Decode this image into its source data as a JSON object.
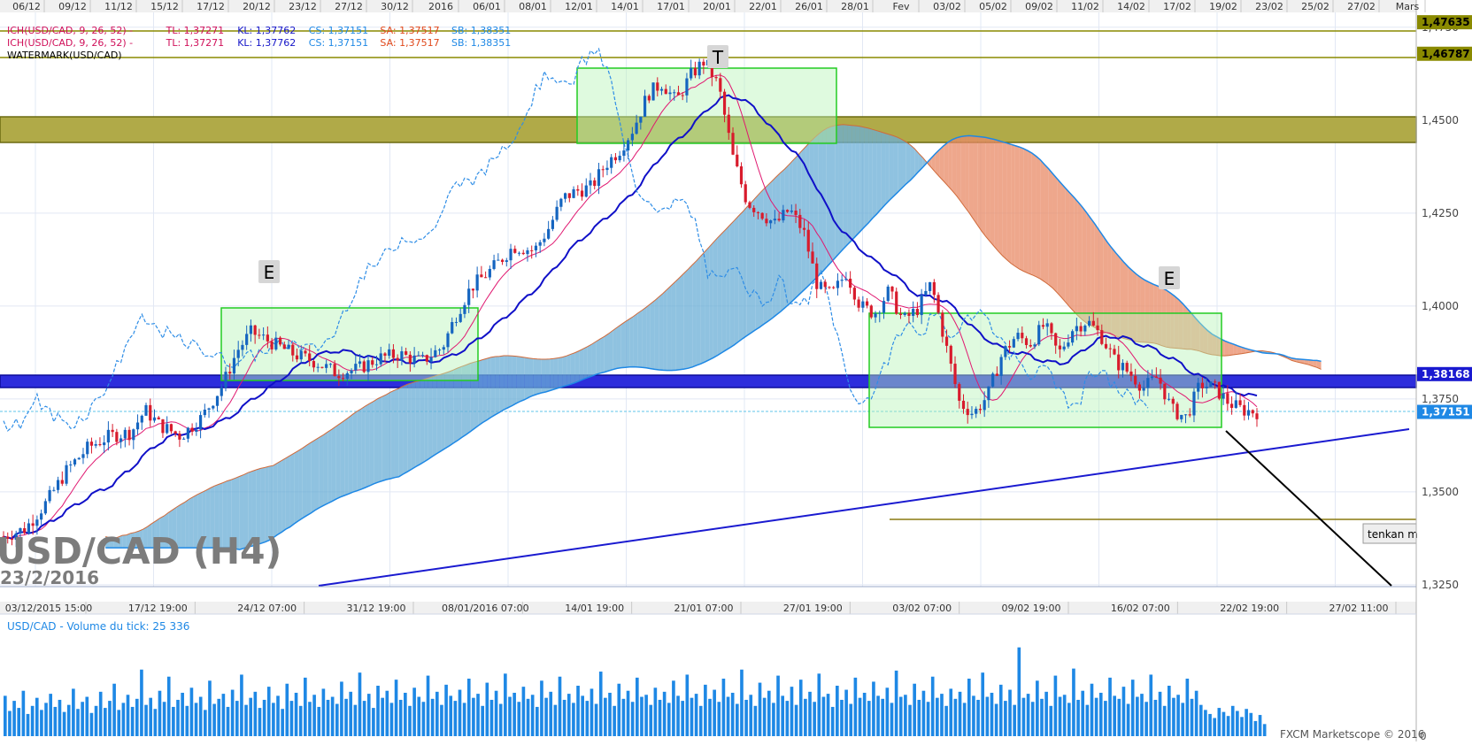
{
  "top_dates": [
    "06/12",
    "09/12",
    "11/12",
    "15/12",
    "17/12",
    "20/12",
    "23/12",
    "27/12",
    "30/12",
    "2016",
    "06/01",
    "08/01",
    "12/01",
    "14/01",
    "17/01",
    "20/01",
    "22/01",
    "26/01",
    "28/01",
    "Fev",
    "03/02",
    "05/02",
    "09/02",
    "11/02",
    "14/02",
    "17/02",
    "19/02",
    "23/02",
    "25/02",
    "27/02",
    "Mars"
  ],
  "bottom_dates": [
    "03/12/2015 15:00",
    "17/12 19:00",
    "24/12 07:00",
    "31/12 19:00",
    "08/01/2016 07:00",
    "14/01 19:00",
    "21/01 07:00",
    "27/01 19:00",
    "03/02 07:00",
    "09/02 19:00",
    "16/02 07:00",
    "22/02 19:00",
    "27/02 11:00"
  ],
  "legend": [
    {
      "parts": [
        "ICH(USD/CAD, 9, 26, 52) - ",
        "TL: 1,37271",
        "KL: 1,37762",
        "CS: 1,37151",
        "SA: 1,37517",
        "SB: 1,38351"
      ]
    },
    {
      "parts": [
        "ICH(USD/CAD, 9, 26, 52) - ",
        "TL: 1,37271",
        "KL: 1,37762",
        "CS: 1,37151",
        "SA: 1,37517",
        "SB: 1,38351"
      ]
    },
    {
      "parts": [
        "WATERMARK(USD/CAD)"
      ]
    }
  ],
  "legend_colors": [
    "#d0105a",
    "#1515c8",
    "#1e88e5",
    "#e0481a",
    "#1e88e5"
  ],
  "watermark": {
    "symbol": "USD/CAD (H4)",
    "date": "23/2/2016"
  },
  "annotations": [
    "E",
    "T",
    "E"
  ],
  "tenkan_note": "tenkan m",
  "volume_label": "USD/CAD - Volume du tick: 25 336",
  "copyright": "FXCM Marketscope © 2016",
  "chart_data": [
    {
      "type": "candlestick",
      "symbol": "USD/CAD",
      "timeframe": "H4",
      "y_ticks": [
        "1,4750",
        "1,4500",
        "1,4250",
        "1,4000",
        "1,3750",
        "1,3500",
        "1,3250"
      ],
      "price_tags": [
        {
          "label": "1,47635",
          "color": "#8a8a00",
          "text_color": "#000000"
        },
        {
          "label": "1,46787",
          "color": "#8a8a00",
          "text_color": "#000000"
        },
        {
          "label": "1,38168",
          "color": "#1a1ad0",
          "text_color": "#ffffff"
        },
        {
          "label": "1,37151",
          "color": "#1e88e5",
          "text_color": "#ffffff"
        }
      ],
      "ylim": [
        1.3245,
        1.479
      ],
      "grid": true,
      "colors": {
        "up": "#1565c0",
        "down": "#d81b2c",
        "tenkan": "#e01870",
        "kijun": "#1010c8",
        "chikou": "#2e8de6",
        "kumo_bull": "#6aaed6",
        "kumo_bear": "#e88a66",
        "resistance_zone": "#b0aa48"
      },
      "horizontal_levels": [
        {
          "value": 1.47635,
          "label": "1,47635"
        },
        {
          "value": 1.46787,
          "label": "1,46787"
        },
        {
          "value": 1.38168,
          "label": "1,38168"
        },
        {
          "value": 1.37151,
          "label": "1,37151"
        },
        {
          "value": 1.342
        }
      ],
      "resistance_zone": [
        1.445,
        1.4515
      ],
      "support_zone": [
        1.3795,
        1.3825
      ],
      "trendline": {
        "from": [
          "03/12/2015",
          1.324
        ],
        "to": [
          "27/02/2016",
          1.367
        ]
      },
      "price_path": [
        [
          0,
          1.338
        ],
        [
          0.015,
          1.34
        ],
        [
          0.03,
          1.347
        ],
        [
          0.045,
          1.356
        ],
        [
          0.06,
          1.362
        ],
        [
          0.075,
          1.365
        ],
        [
          0.09,
          1.366
        ],
        [
          0.1,
          1.372
        ],
        [
          0.11,
          1.368
        ],
        [
          0.125,
          1.365
        ],
        [
          0.14,
          1.37
        ],
        [
          0.155,
          1.379
        ],
        [
          0.165,
          1.388
        ],
        [
          0.175,
          1.393
        ],
        [
          0.19,
          1.39
        ],
        [
          0.205,
          1.387
        ],
        [
          0.22,
          1.385
        ],
        [
          0.235,
          1.382
        ],
        [
          0.25,
          1.383
        ],
        [
          0.265,
          1.386
        ],
        [
          0.28,
          1.387
        ],
        [
          0.295,
          1.385
        ],
        [
          0.31,
          1.389
        ],
        [
          0.32,
          1.398
        ],
        [
          0.33,
          1.405
        ],
        [
          0.345,
          1.41
        ],
        [
          0.36,
          1.416
        ],
        [
          0.375,
          1.415
        ],
        [
          0.385,
          1.421
        ],
        [
          0.395,
          1.429
        ],
        [
          0.405,
          1.431
        ],
        [
          0.415,
          1.432
        ],
        [
          0.425,
          1.438
        ],
        [
          0.435,
          1.442
        ],
        [
          0.445,
          1.448
        ],
        [
          0.455,
          1.457
        ],
        [
          0.465,
          1.46
        ],
        [
          0.475,
          1.455
        ],
        [
          0.485,
          1.462
        ],
        [
          0.495,
          1.466
        ],
        [
          0.505,
          1.459
        ],
        [
          0.515,
          1.44
        ],
        [
          0.525,
          1.428
        ],
        [
          0.535,
          1.425
        ],
        [
          0.545,
          1.422
        ],
        [
          0.555,
          1.426
        ],
        [
          0.565,
          1.42
        ],
        [
          0.575,
          1.405
        ],
        [
          0.585,
          1.403
        ],
        [
          0.595,
          1.409
        ],
        [
          0.605,
          1.4
        ],
        [
          0.615,
          1.398
        ],
        [
          0.625,
          1.404
        ],
        [
          0.635,
          1.396
        ],
        [
          0.645,
          1.399
        ],
        [
          0.655,
          1.406
        ],
        [
          0.665,
          1.39
        ],
        [
          0.675,
          1.374
        ],
        [
          0.685,
          1.371
        ],
        [
          0.695,
          1.376
        ],
        [
          0.705,
          1.387
        ],
        [
          0.715,
          1.392
        ],
        [
          0.725,
          1.39
        ],
        [
          0.735,
          1.395
        ],
        [
          0.745,
          1.387
        ],
        [
          0.755,
          1.394
        ],
        [
          0.765,
          1.396
        ],
        [
          0.775,
          1.392
        ],
        [
          0.785,
          1.385
        ],
        [
          0.795,
          1.382
        ],
        [
          0.805,
          1.378
        ],
        [
          0.815,
          1.381
        ],
        [
          0.825,
          1.372
        ],
        [
          0.835,
          1.37
        ],
        [
          0.845,
          1.379
        ],
        [
          0.855,
          1.378
        ],
        [
          0.865,
          1.374
        ],
        [
          0.875,
          1.372
        ],
        [
          0.885,
          1.3715
        ]
      ]
    },
    {
      "type": "bar",
      "title": "USD/CAD - Volume du tick: 25 336",
      "series": [
        {
          "name": "Volume du tick",
          "color": "#1e88e5"
        }
      ],
      "ylim": [
        0,
        1
      ],
      "values": [
        0.4,
        0.25,
        0.35,
        0.28,
        0.45,
        0.22,
        0.3,
        0.38,
        0.26,
        0.33,
        0.42,
        0.29,
        0.36,
        0.24,
        0.31,
        0.47,
        0.27,
        0.34,
        0.39,
        0.23,
        0.3,
        0.44,
        0.28,
        0.35,
        0.52,
        0.26,
        0.33,
        0.41,
        0.29,
        0.37,
        0.66,
        0.31,
        0.38,
        0.27,
        0.45,
        0.34,
        0.59,
        0.29,
        0.36,
        0.43,
        0.3,
        0.48,
        0.33,
        0.39,
        0.26,
        0.55,
        0.32,
        0.37,
        0.42,
        0.29,
        0.46,
        0.35,
        0.61,
        0.31,
        0.38,
        0.44,
        0.28,
        0.36,
        0.49,
        0.33,
        0.4,
        0.27,
        0.52,
        0.35,
        0.43,
        0.3,
        0.58,
        0.34,
        0.41,
        0.29,
        0.47,
        0.36,
        0.39,
        0.32,
        0.54,
        0.37,
        0.44,
        0.31,
        0.63,
        0.35,
        0.42,
        0.28,
        0.5,
        0.38,
        0.45,
        0.33,
        0.56,
        0.36,
        0.43,
        0.3,
        0.48,
        0.39,
        0.34,
        0.6,
        0.37,
        0.44,
        0.31,
        0.51,
        0.4,
        0.35,
        0.46,
        0.33,
        0.57,
        0.38,
        0.42,
        0.3,
        0.53,
        0.36,
        0.45,
        0.32,
        0.62,
        0.39,
        0.43,
        0.34,
        0.49,
        0.37,
        0.41,
        0.29,
        0.55,
        0.38,
        0.44,
        0.31,
        0.59,
        0.36,
        0.42,
        0.33,
        0.5,
        0.4,
        0.35,
        0.47,
        0.32,
        0.64,
        0.38,
        0.43,
        0.3,
        0.52,
        0.37,
        0.45,
        0.34,
        0.58,
        0.39,
        0.41,
        0.31,
        0.48,
        0.36,
        0.44,
        0.33,
        0.55,
        0.4,
        0.35,
        0.61,
        0.38,
        0.42,
        0.3,
        0.51,
        0.37,
        0.46,
        0.34,
        0.57,
        0.39,
        0.43,
        0.32,
        0.66,
        0.36,
        0.41,
        0.3,
        0.53,
        0.38,
        0.45,
        0.33,
        0.6,
        0.4,
        0.35,
        0.49,
        0.31,
        0.56,
        0.37,
        0.44,
        0.34,
        0.62,
        0.39,
        0.42,
        0.29,
        0.5,
        0.36,
        0.46,
        0.32,
        0.58,
        0.38,
        0.43,
        0.35,
        0.54,
        0.4,
        0.37,
        0.48,
        0.33,
        0.65,
        0.39,
        0.41,
        0.31,
        0.52,
        0.36,
        0.45,
        0.34,
        0.59,
        0.38,
        0.42,
        0.3,
        0.47,
        0.37,
        0.44,
        0.33,
        0.57,
        0.4,
        0.36,
        0.63,
        0.39,
        0.43,
        0.32,
        0.51,
        0.35,
        0.46,
        0.31,
        0.88,
        0.38,
        0.42,
        0.34,
        0.55,
        0.37,
        0.44,
        0.3,
        0.6,
        0.39,
        0.41,
        0.33,
        0.67,
        0.36,
        0.45,
        0.31,
        0.52,
        0.38,
        0.43,
        0.35,
        0.58,
        0.4,
        0.37,
        0.49,
        0.32,
        0.56,
        0.39,
        0.42,
        0.34,
        0.61,
        0.36,
        0.44,
        0.3,
        0.5,
        0.38,
        0.41,
        0.33,
        0.57,
        0.37,
        0.45,
        0.31,
        0.26,
        0.22,
        0.18,
        0.28,
        0.24,
        0.2,
        0.3,
        0.25,
        0.19,
        0.27,
        0.23,
        0.15,
        0.21,
        0.12
      ]
    }
  ]
}
